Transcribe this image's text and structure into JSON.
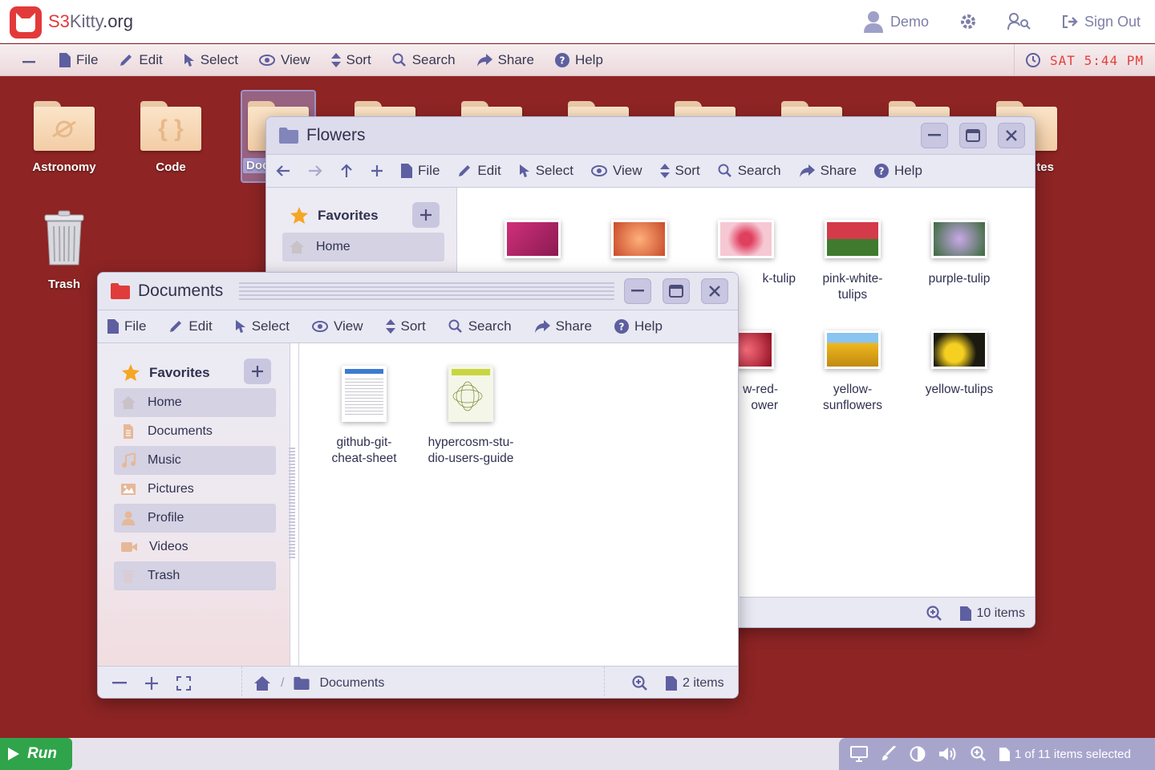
{
  "app": {
    "logo_prefix": "S3",
    "logo_mid": "Kitty",
    "logo_suffix": ".org"
  },
  "header": {
    "user_label": "Demo",
    "signout_label": "Sign Out",
    "icons": [
      "user-icon",
      "gear-icon",
      "user-search-icon",
      "sign-out-icon"
    ]
  },
  "menubar": {
    "items": [
      "File",
      "Edit",
      "Select",
      "View",
      "Sort",
      "Search",
      "Share",
      "Help"
    ],
    "clock": "SAT 5:44 PM"
  },
  "desktop": {
    "icons": [
      {
        "label": "Astronomy",
        "glyph": "planet"
      },
      {
        "label": "Code",
        "glyph": "{ }"
      },
      {
        "label": "Doc",
        "glyph": ""
      },
      {
        "label": "tes",
        "glyph": ""
      },
      {
        "label": "Trash",
        "glyph": "trash"
      }
    ]
  },
  "flowers_window": {
    "title": "Flowers",
    "menu": [
      "File",
      "Edit",
      "Select",
      "View",
      "Sort",
      "Search",
      "Share",
      "Help"
    ],
    "favorites_label": "Favorites",
    "sidebar_items": [
      "Home"
    ],
    "files": [
      {
        "name": "",
        "color": "#b42a6e"
      },
      {
        "name": "",
        "color": "#e86a3a"
      },
      {
        "name": "k-tulip",
        "color": "#f2b8c6"
      },
      {
        "name": "pink-white-tulips",
        "line1": "pink-white-",
        "line2": "tulips",
        "color": "#d33a4a"
      },
      {
        "name": "purple-tulip",
        "color": "#9a7ac8"
      },
      {
        "name": "w-red-ower",
        "line1": "w-red-",
        "line2": "ower",
        "color": "#b01c2a"
      },
      {
        "name": "yellow-sunflowers",
        "line1": "yellow-",
        "line2": "sunflowers",
        "color": "#e5b424"
      },
      {
        "name": "yellow-tulips",
        "color": "#f0c81e"
      }
    ],
    "status_count": "10 items"
  },
  "documents_window": {
    "title": "Documents",
    "menu": [
      "File",
      "Edit",
      "Select",
      "View",
      "Sort",
      "Search",
      "Share",
      "Help"
    ],
    "favorites_label": "Favorites",
    "sidebar_items": [
      "Home",
      "Documents",
      "Music",
      "Pictures",
      "Profile",
      "Videos",
      "Trash"
    ],
    "files": [
      {
        "line1": "github-git-",
        "line2": "cheat-sheet"
      },
      {
        "line1": "hypercosm-stu-",
        "line2": "dio-users-guide"
      }
    ],
    "breadcrumb": "Documents",
    "status_count": "2 items"
  },
  "taskbar": {
    "run_label": "Run",
    "selection_status": "1 of 11 items selected"
  }
}
